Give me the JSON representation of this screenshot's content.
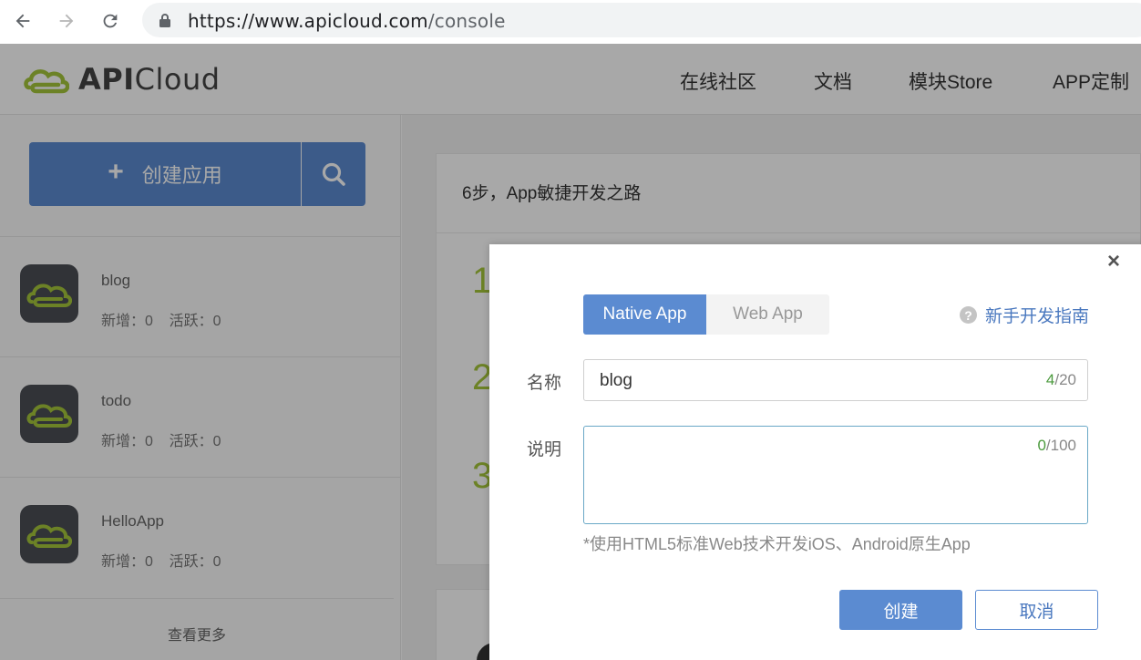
{
  "browser": {
    "url_host": "https://www.apicloud.com",
    "url_path": "/console"
  },
  "header": {
    "logo_bold": "API",
    "logo_light": "Cloud",
    "nav": [
      "在线社区",
      "文档",
      "模块Store",
      "APP定制"
    ]
  },
  "sidebar": {
    "create_label": "创建应用",
    "apps": [
      {
        "name": "blog",
        "stats": "新增：0    活跃：0"
      },
      {
        "name": "todo",
        "stats": "新增：0    活跃：0"
      },
      {
        "name": "HelloApp",
        "stats": "新增：0    活跃：0"
      }
    ],
    "more_label": "查看更多"
  },
  "main": {
    "steps_title": "6步，App敏捷开发之路",
    "step_numbers": [
      "1",
      "2",
      "3"
    ]
  },
  "modal": {
    "tabs": [
      "Native App",
      "Web App"
    ],
    "active_tab": "Native App",
    "guide_label": "新手开发指南",
    "name_label": "名称",
    "name_value": "blog",
    "name_count": "4",
    "name_max": "/20",
    "desc_label": "说明",
    "desc_value": "",
    "desc_count": "0",
    "desc_max": "/100",
    "hint": "*使用HTML5标准Web技术开发iOS、Android原生App",
    "ok_label": "创建",
    "cancel_label": "取消",
    "close_symbol": "×"
  },
  "colors": {
    "primary": "#5b8bd1",
    "accent_green": "#a5c63b",
    "counter_green": "#4b9a3d",
    "icon_bg": "#4b4e54"
  }
}
